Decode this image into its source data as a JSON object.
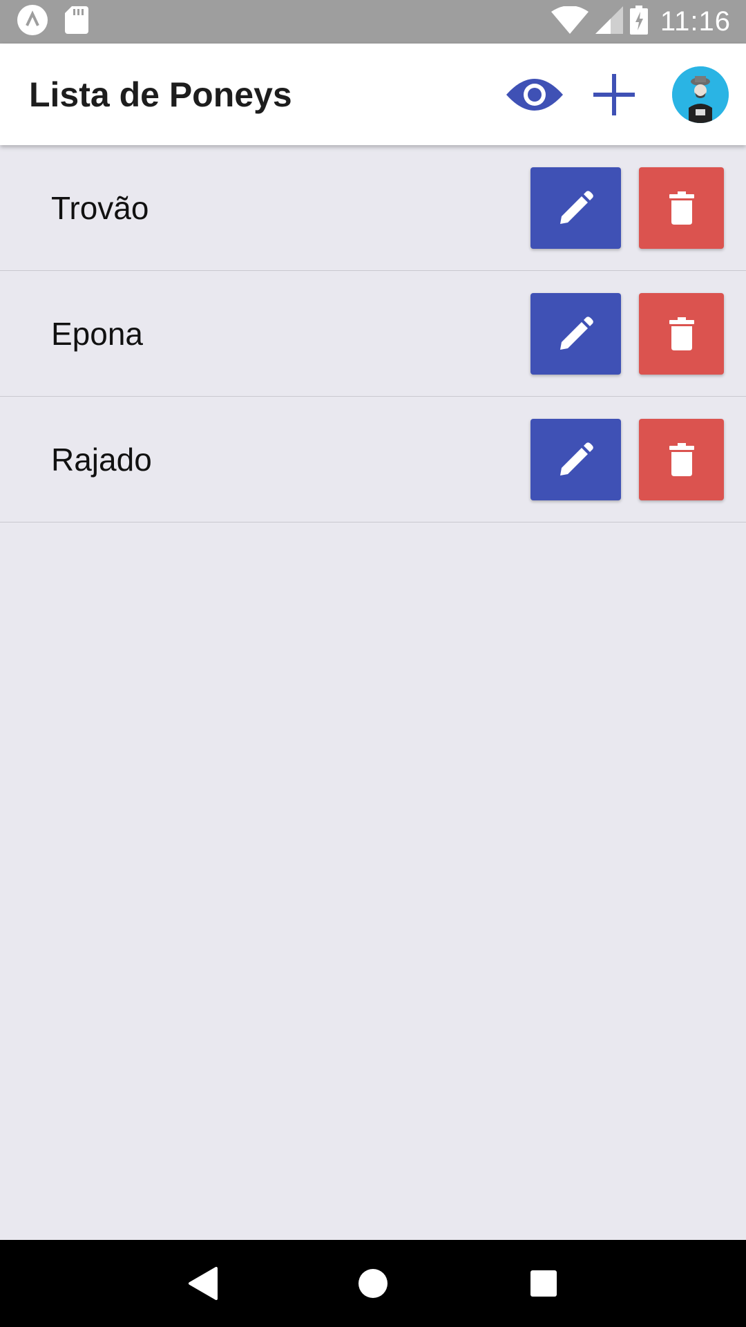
{
  "status_bar": {
    "time": "11:16",
    "left_icons": [
      "app-notification-icon",
      "sd-card-icon"
    ],
    "right_icons": [
      "wifi-icon",
      "cell-signal-icon",
      "battery-charging-icon"
    ]
  },
  "app_bar": {
    "title": "Lista de Poneys",
    "actions": [
      "eye-icon",
      "plus-icon",
      "avatar"
    ]
  },
  "ponies": [
    {
      "name": "Trovão"
    },
    {
      "name": "Epona"
    },
    {
      "name": "Rajado"
    }
  ],
  "nav_bar": {
    "buttons": [
      "back-icon",
      "home-icon",
      "recents-icon"
    ]
  },
  "colors": {
    "primary": "#3f51b5",
    "danger": "#db534f",
    "background": "#e9e8ef",
    "status_bar": "#9e9e9e"
  }
}
